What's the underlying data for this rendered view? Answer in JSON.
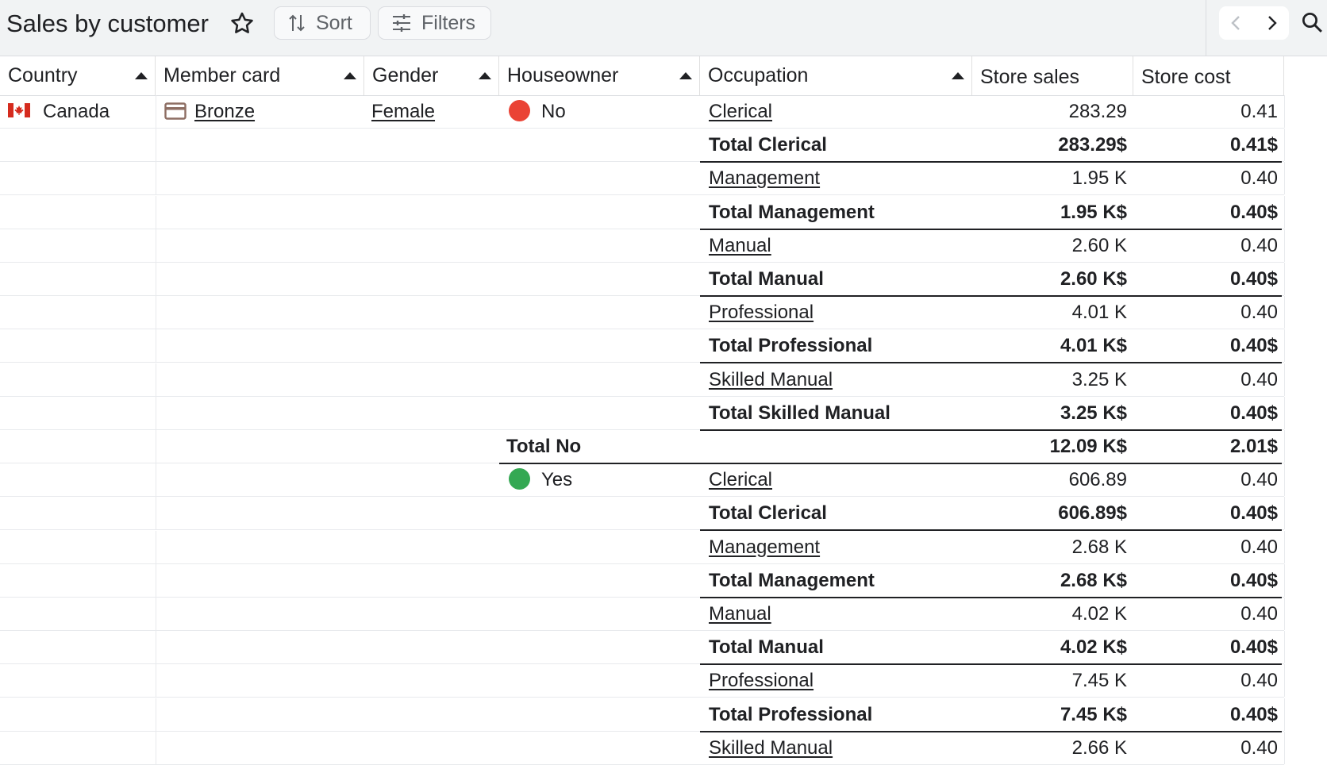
{
  "toolbar": {
    "title": "Sales by customer",
    "sort_label": "Sort",
    "filters_label": "Filters"
  },
  "columns": [
    "Country",
    "Member card",
    "Gender",
    "Houseowner",
    "Occupation",
    "Store sales",
    "Store cost"
  ],
  "first_row": {
    "country": "Canada",
    "member_card": "Bronze",
    "gender": "Female",
    "houseowner": "No",
    "occupation": "Clerical",
    "store_sales": "283.29",
    "store_cost": "0.41"
  },
  "rows": [
    {
      "kind": "total",
      "label": "Total Clerical",
      "sales": "283.29$",
      "cost": "0.41$"
    },
    {
      "kind": "detail",
      "label": "Management",
      "sales": "1.95 K",
      "cost": "0.40"
    },
    {
      "kind": "total",
      "label": "Total Management",
      "sales": "1.95 K$",
      "cost": "0.40$"
    },
    {
      "kind": "detail",
      "label": "Manual",
      "sales": "2.60 K",
      "cost": "0.40"
    },
    {
      "kind": "total",
      "label": "Total Manual",
      "sales": "2.60 K$",
      "cost": "0.40$"
    },
    {
      "kind": "detail",
      "label": "Professional",
      "sales": "4.01 K",
      "cost": "0.40"
    },
    {
      "kind": "total",
      "label": "Total Professional",
      "sales": "4.01 K$",
      "cost": "0.40$"
    },
    {
      "kind": "detail",
      "label": "Skilled Manual",
      "sales": "3.25 K",
      "cost": "0.40"
    },
    {
      "kind": "total",
      "label": "Total Skilled Manual",
      "sales": "3.25 K$",
      "cost": "0.40$"
    },
    {
      "kind": "group-total",
      "label": "Total No",
      "sales": "12.09 K$",
      "cost": "2.01$"
    },
    {
      "kind": "group-start",
      "group": "Yes",
      "label": "Clerical",
      "sales": "606.89",
      "cost": "0.40"
    },
    {
      "kind": "total",
      "label": "Total Clerical",
      "sales": "606.89$",
      "cost": "0.40$"
    },
    {
      "kind": "detail",
      "label": "Management",
      "sales": "2.68 K",
      "cost": "0.40"
    },
    {
      "kind": "total",
      "label": "Total Management",
      "sales": "2.68 K$",
      "cost": "0.40$"
    },
    {
      "kind": "detail",
      "label": "Manual",
      "sales": "4.02 K",
      "cost": "0.40"
    },
    {
      "kind": "total",
      "label": "Total Manual",
      "sales": "4.02 K$",
      "cost": "0.40$"
    },
    {
      "kind": "detail",
      "label": "Professional",
      "sales": "7.45 K",
      "cost": "0.40"
    },
    {
      "kind": "total",
      "label": "Total Professional",
      "sales": "7.45 K$",
      "cost": "0.40$"
    },
    {
      "kind": "detail",
      "label": "Skilled Manual",
      "sales": "2.66 K",
      "cost": "0.40"
    }
  ],
  "colors": {
    "no_dot": "#ea4335",
    "yes_dot": "#34a853",
    "flag_red": "#d52b1e"
  }
}
